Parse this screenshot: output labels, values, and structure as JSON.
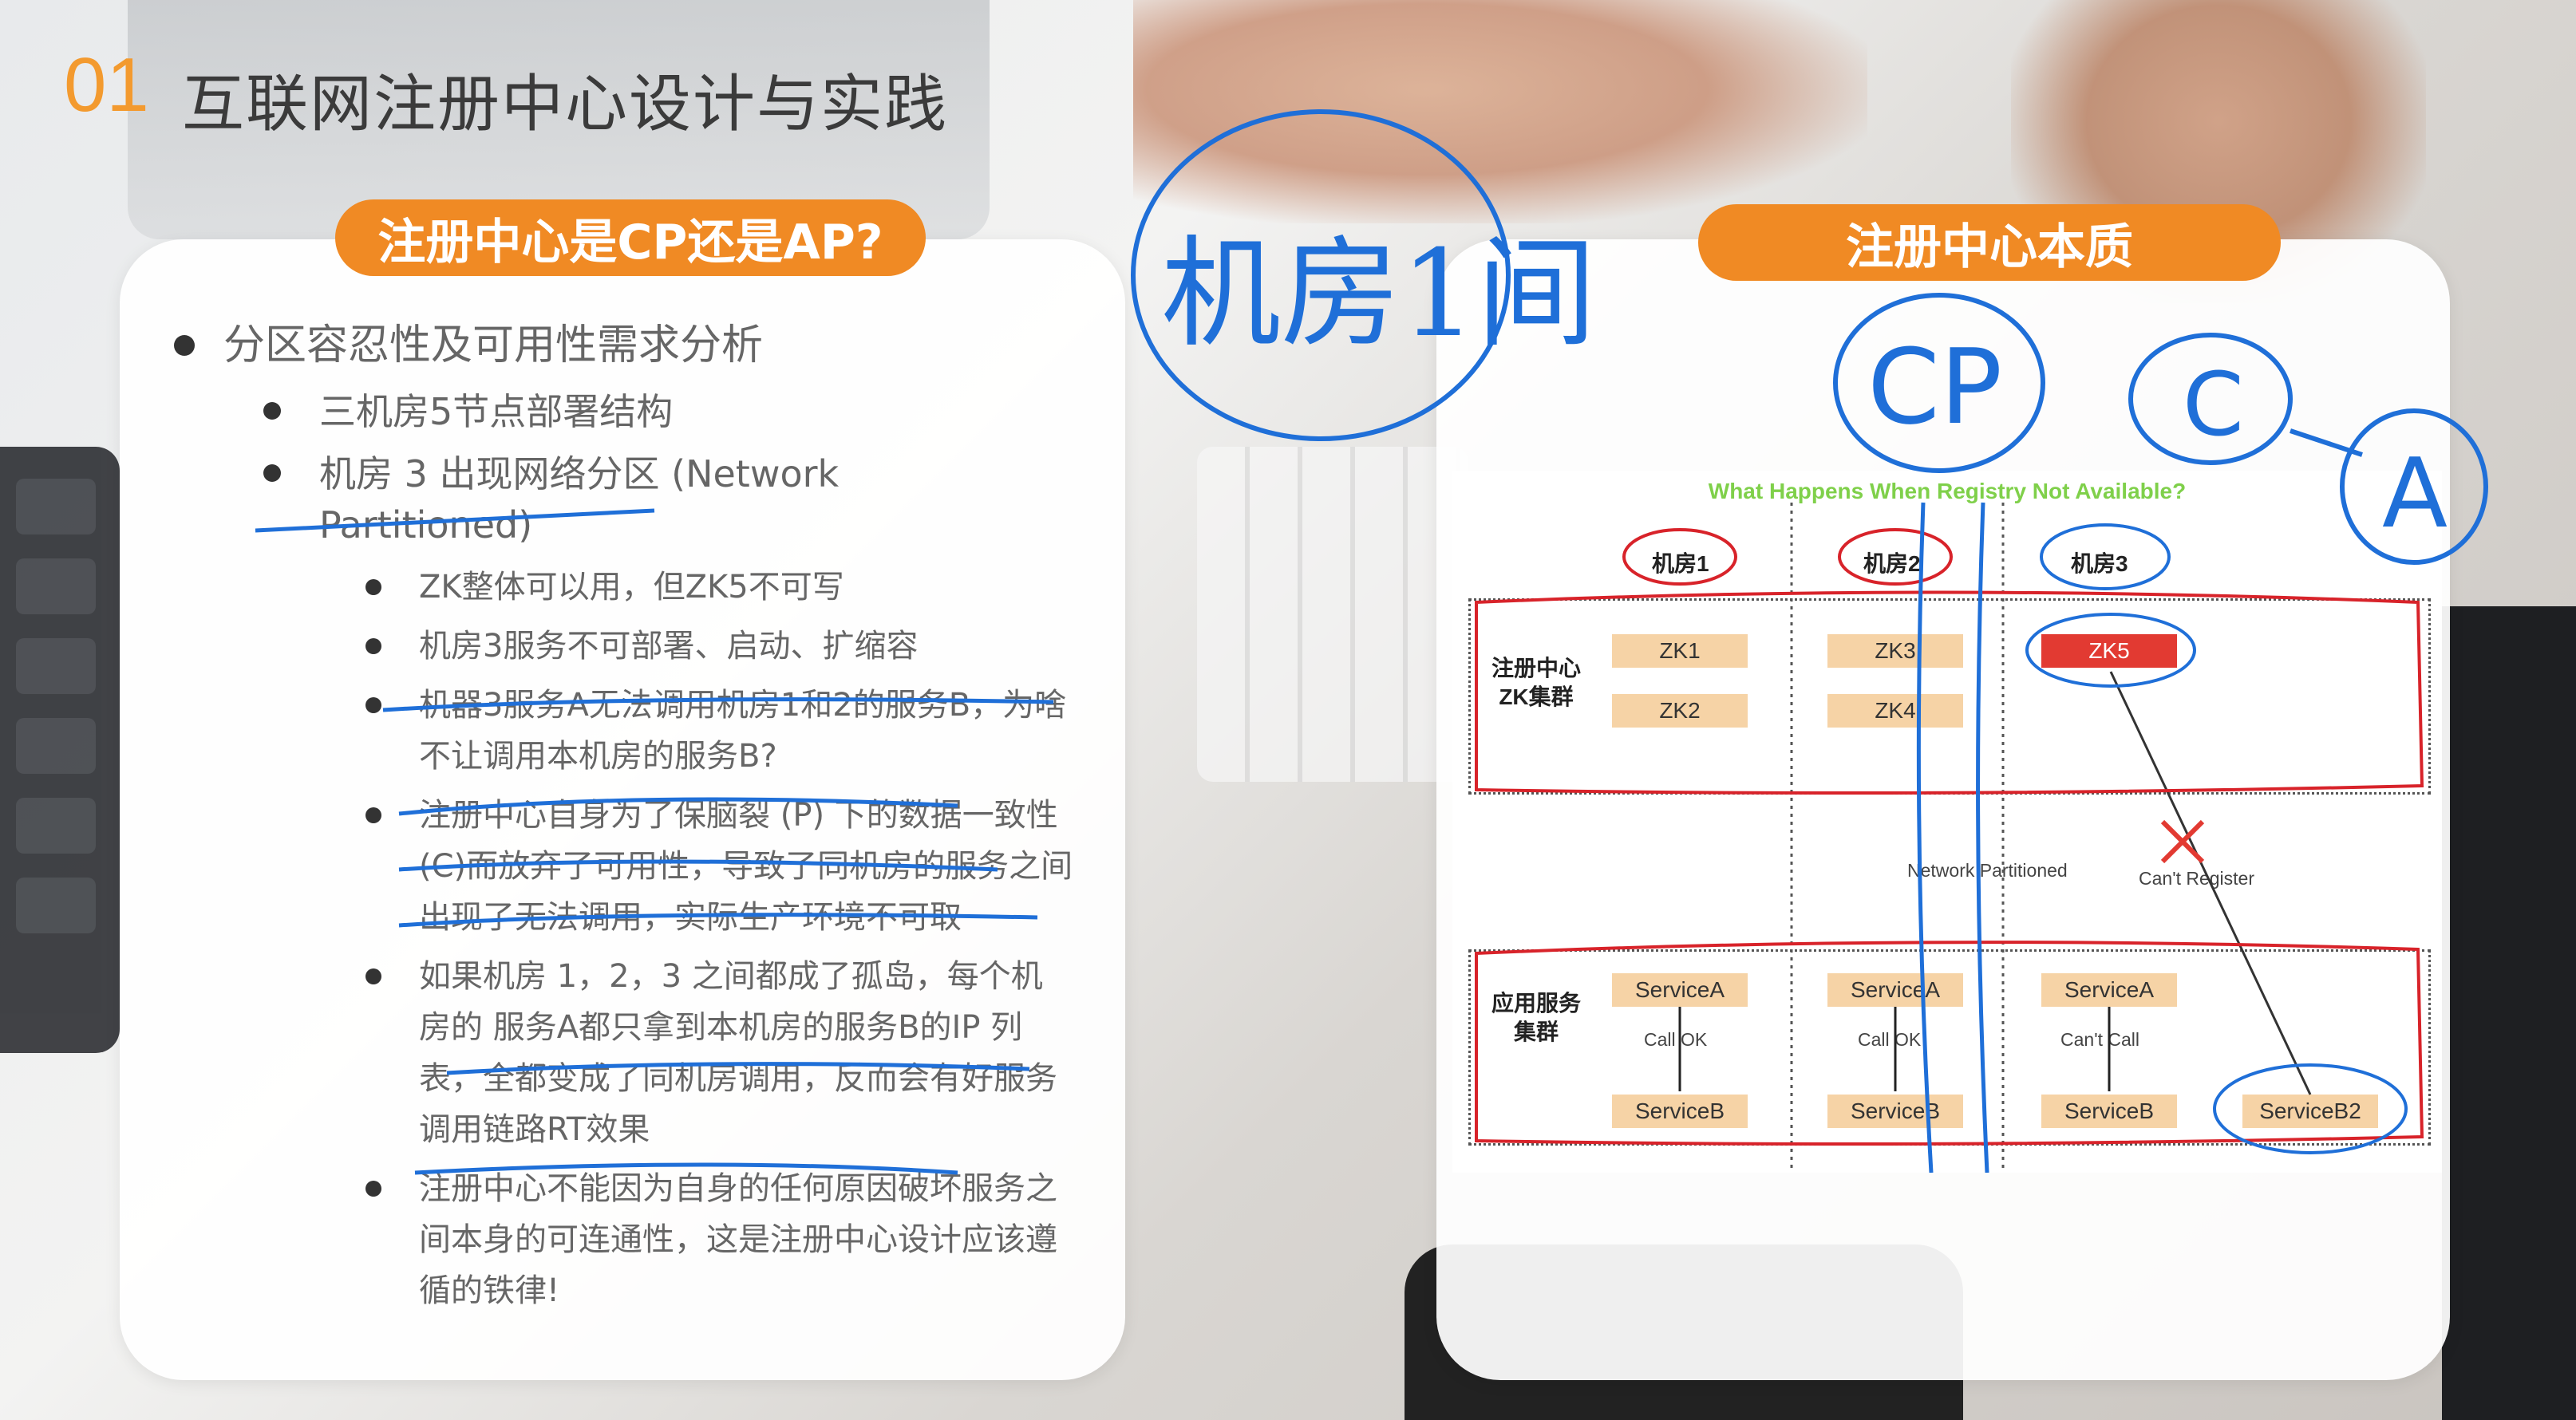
{
  "header": {
    "number": "01",
    "title": "互联网注册中心设计与实践"
  },
  "left_card": {
    "pill": "注册中心是CP还是AP?",
    "items": [
      {
        "level": 1,
        "text": "分区容忍性及可用性需求分析"
      },
      {
        "level": 2,
        "text": "三机房5节点部署结构"
      },
      {
        "level": 2,
        "text": "机房 3 出现网络分区 (Network Partitioned)"
      },
      {
        "level": 3,
        "text": "ZK整体可以用，但ZK5不可写"
      },
      {
        "level": 3,
        "text": "机房3服务不可部署、启动、扩缩容"
      },
      {
        "level": 3,
        "text": "机器3服务A无法调用机房1和2的服务B，为啥不让调用本机房的服务B?"
      },
      {
        "level": 3,
        "text": "注册中心自身为了保脑裂 (P) 下的数据一致性(C)而放弃了可用性，导致了同机房的服务之间出现了无法调用，实际生产环境不可取"
      },
      {
        "level": 3,
        "text": "如果机房 1，2，3 之间都成了孤岛，每个机房的 服务A都只拿到本机房的服务B的IP 列表，全都变成了同机房调用，反而会有好服务调用链路RT效果"
      },
      {
        "level": 3,
        "text": "注册中心不能因为自身的任何原因破坏服务之间本身的可连通性，这是注册中心设计应该遵循的铁律!"
      }
    ]
  },
  "right_card": {
    "pill": "注册中心本质",
    "diagram": {
      "title": "What Happens When Registry Not Available?",
      "columns": [
        "机房1",
        "机房2",
        "机房3"
      ],
      "zk_label": "注册中心\nZK集群",
      "zk_nodes": [
        "ZK1",
        "ZK2",
        "ZK3",
        "ZK4",
        "ZK5"
      ],
      "network_label": "Network Partitioned",
      "cant_register": "Can't Register",
      "app_label": "应用服务\n集群",
      "service_a": "ServiceA",
      "service_b": "ServiceB",
      "service_b2": "ServiceB2",
      "call_ok": "Call OK",
      "cant_call": "Can't Call"
    }
  },
  "annotations": {
    "handwriting": [
      "机房1间",
      "CP",
      "C",
      "A"
    ]
  },
  "colors": {
    "accent": "#f08a24",
    "ink_blue": "#1f6fd8",
    "ink_red": "#d8232a",
    "zk5": "#e23a32"
  }
}
